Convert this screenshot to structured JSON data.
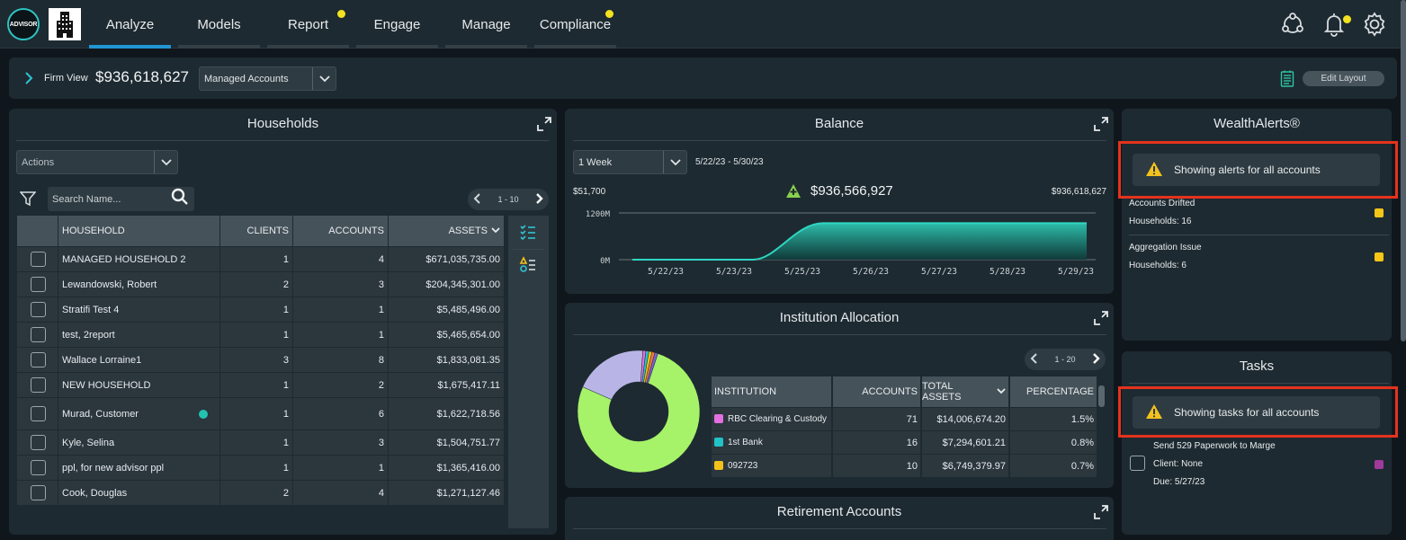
{
  "nav": {
    "logo_text": "ADVISOR",
    "tabs": [
      {
        "label": "Analyze",
        "active": true,
        "dot": false
      },
      {
        "label": "Models",
        "active": false,
        "dot": false
      },
      {
        "label": "Report",
        "active": false,
        "dot": true
      },
      {
        "label": "Engage",
        "active": false,
        "dot": false
      },
      {
        "label": "Manage",
        "active": false,
        "dot": false
      },
      {
        "label": "Compliance",
        "active": false,
        "dot": true
      }
    ],
    "icons": [
      "network-icon",
      "bell-icon",
      "gear-icon"
    ],
    "dot_color": "#f2e21f",
    "active_color": "#2196d3"
  },
  "subbar": {
    "firm_view_label": "Firm View",
    "firm_total": "$936,618,627",
    "view_select": "Managed Accounts",
    "edit_layout": "Edit Layout"
  },
  "households": {
    "title": "Households",
    "actions_select": "Actions",
    "search_placeholder": "Search Name...",
    "pager": "1 - 10",
    "columns": [
      "HOUSEHOLD",
      "CLIENTS",
      "ACCOUNTS",
      "ASSETS"
    ],
    "rows": [
      {
        "name": "MANAGED HOUSEHOLD 2",
        "clients": "1",
        "accounts": "4",
        "assets": "$671,035,735.00",
        "dot": false
      },
      {
        "name": "Lewandowski, Robert",
        "clients": "2",
        "accounts": "3",
        "assets": "$204,345,301.00",
        "dot": false
      },
      {
        "name": "Stratifi Test 4",
        "clients": "1",
        "accounts": "1",
        "assets": "$5,485,496.00",
        "dot": false
      },
      {
        "name": "test, 2report",
        "clients": "1",
        "accounts": "1",
        "assets": "$5,465,654.00",
        "dot": false
      },
      {
        "name": "Wallace Lorraine1",
        "clients": "3",
        "accounts": "8",
        "assets": "$1,833,081.35",
        "dot": false
      },
      {
        "name": "NEW HOUSEHOLD",
        "clients": "1",
        "accounts": "2",
        "assets": "$1,675,417.11",
        "dot": false
      },
      {
        "name": "Murad, Customer",
        "clients": "1",
        "accounts": "6",
        "assets": "$1,622,718.56",
        "dot": true
      },
      {
        "name": "Kyle, Selina",
        "clients": "1",
        "accounts": "3",
        "assets": "$1,504,751.77",
        "dot": false
      },
      {
        "name": "ppl, for new advisor ppl",
        "clients": "1",
        "accounts": "1",
        "assets": "$1,365,416.00",
        "dot": false
      },
      {
        "name": "Cook, Douglas",
        "clients": "2",
        "accounts": "4",
        "assets": "$1,271,127.46",
        "dot": false
      }
    ]
  },
  "balance": {
    "title": "Balance",
    "period_select": "1 Week",
    "date_range": "5/22/23 - 5/30/23",
    "start_value": "$51,700",
    "change_value": "$936,566,927",
    "end_value": "$936,618,627",
    "y_ticks": [
      "1200M",
      "0M"
    ],
    "x_ticks": [
      "5/22/23",
      "5/23/23",
      "5/25/23",
      "5/26/23",
      "5/27/23",
      "5/28/23",
      "5/29/23"
    ],
    "accent": "#22c3b0"
  },
  "chart_data": {
    "type": "area",
    "title": "Balance",
    "x": [
      "5/22/23",
      "5/23/23",
      "5/25/23",
      "5/26/23",
      "5/27/23",
      "5/28/23",
      "5/29/23",
      "5/30/23"
    ],
    "values": [
      0.0517,
      0.0517,
      0.0517,
      936.6,
      936.6,
      936.6,
      936.6,
      936.6
    ],
    "ylabel": "",
    "ylim": [
      0,
      1200
    ],
    "unit": "M"
  },
  "institution": {
    "title": "Institution Allocation",
    "pager": "1 - 20",
    "columns": [
      "INSTITUTION",
      "ACCOUNTS",
      "TOTAL ASSETS",
      "PERCENTAGE"
    ],
    "rows": [
      {
        "name": "RBC Clearing & Custody",
        "accounts": "71",
        "assets": "$14,006,674.20",
        "pct": "1.5%",
        "color": "#e36fe0"
      },
      {
        "name": "1st Bank",
        "accounts": "16",
        "assets": "$7,294,601.21",
        "pct": "0.8%",
        "color": "#22c3c8"
      },
      {
        "name": "092723",
        "accounts": "10",
        "assets": "$6,749,379.97",
        "pct": "0.7%",
        "color": "#f2c21b"
      }
    ],
    "donut_colors": {
      "main": "#a6f36a",
      "second": "#b8b5e6",
      "small": [
        "#e36fe0",
        "#22c3c8",
        "#f2c21b",
        "#f07b3a",
        "#7a5fd6"
      ]
    }
  },
  "retirement": {
    "title": "Retirement Accounts"
  },
  "wealth_alerts": {
    "title": "WealthAlerts®",
    "banner": "Showing alerts for all accounts",
    "items": [
      {
        "name": "Accounts Drifted",
        "detail": "Households: 16"
      },
      {
        "name": "Aggregation Issue",
        "detail": "Households: 6"
      }
    ],
    "item_color": "#f5c518"
  },
  "tasks": {
    "title": "Tasks",
    "banner": "Showing tasks for all accounts",
    "items": [
      {
        "title": "Send 529 Paperwork to Marge",
        "client": "Client: None",
        "due": "Due: 5/27/23",
        "color": "#a03a9a"
      }
    ]
  }
}
